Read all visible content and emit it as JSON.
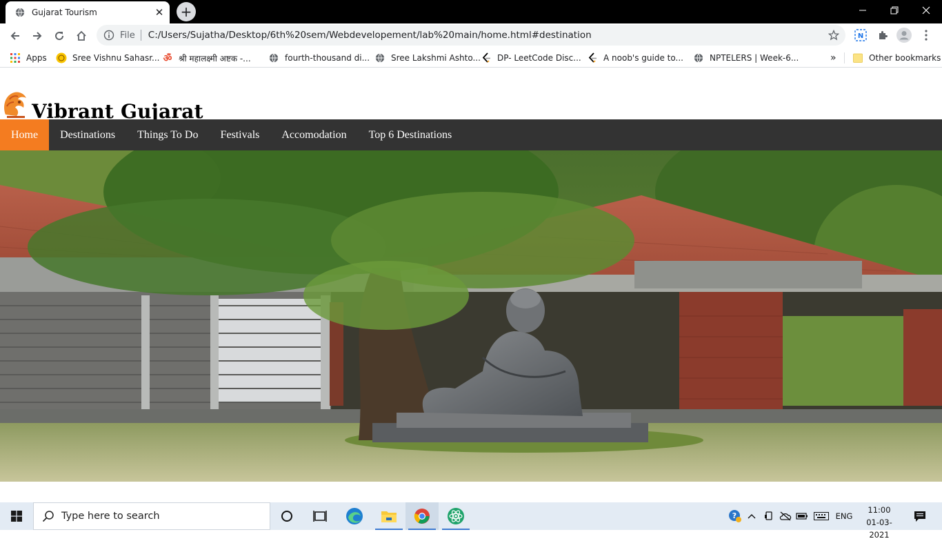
{
  "browser": {
    "tab_title": "Gujarat Tourism",
    "new_tab_label": "+",
    "omnibox": {
      "scheme_label": "File",
      "url": "C:/Users/Sujatha/Desktop/6th%20sem/Webdevelopement/lab%20main/home.html#destination"
    },
    "bookmarks": [
      {
        "label": "Apps",
        "icon": "apps-grid-icon"
      },
      {
        "label": "Sree Vishnu Sahasr...",
        "icon": "vishnu-icon"
      },
      {
        "label": "श्री महालक्ष्मी अष्टक -...",
        "icon": "om-icon"
      },
      {
        "label": "fourth-thousand di...",
        "icon": "globe-icon"
      },
      {
        "label": "Sree Lakshmi Ashto...",
        "icon": "globe-icon"
      },
      {
        "label": "DP- LeetCode Disc...",
        "icon": "leetcode-icon"
      },
      {
        "label": "A noob's guide to...",
        "icon": "leetcode-icon"
      },
      {
        "label": "NPTELERS | Week-6...",
        "icon": "globe-icon"
      }
    ],
    "bookmarks_overflow": "»",
    "other_bookmarks": "Other bookmarks"
  },
  "site": {
    "title": "Vibrant Gujarat",
    "nav": [
      {
        "label": "Home",
        "active": true
      },
      {
        "label": "Destinations",
        "active": false
      },
      {
        "label": "Things To Do",
        "active": false
      },
      {
        "label": "Festivals",
        "active": false
      },
      {
        "label": "Accomodation",
        "active": false
      },
      {
        "label": "Top 6 Destinations",
        "active": false
      }
    ],
    "hero_subject": "Gandhi statue at Sabarmati Ashram"
  },
  "taskbar": {
    "search_placeholder": "Type here to search",
    "language": "ENG",
    "time": "11:00",
    "date": "01-03-2021"
  },
  "colors": {
    "nav_bg": "#333333",
    "nav_active": "#f47c20",
    "tabstrip_bg": "#000000",
    "taskbar_bg": "#e3ebf4"
  }
}
